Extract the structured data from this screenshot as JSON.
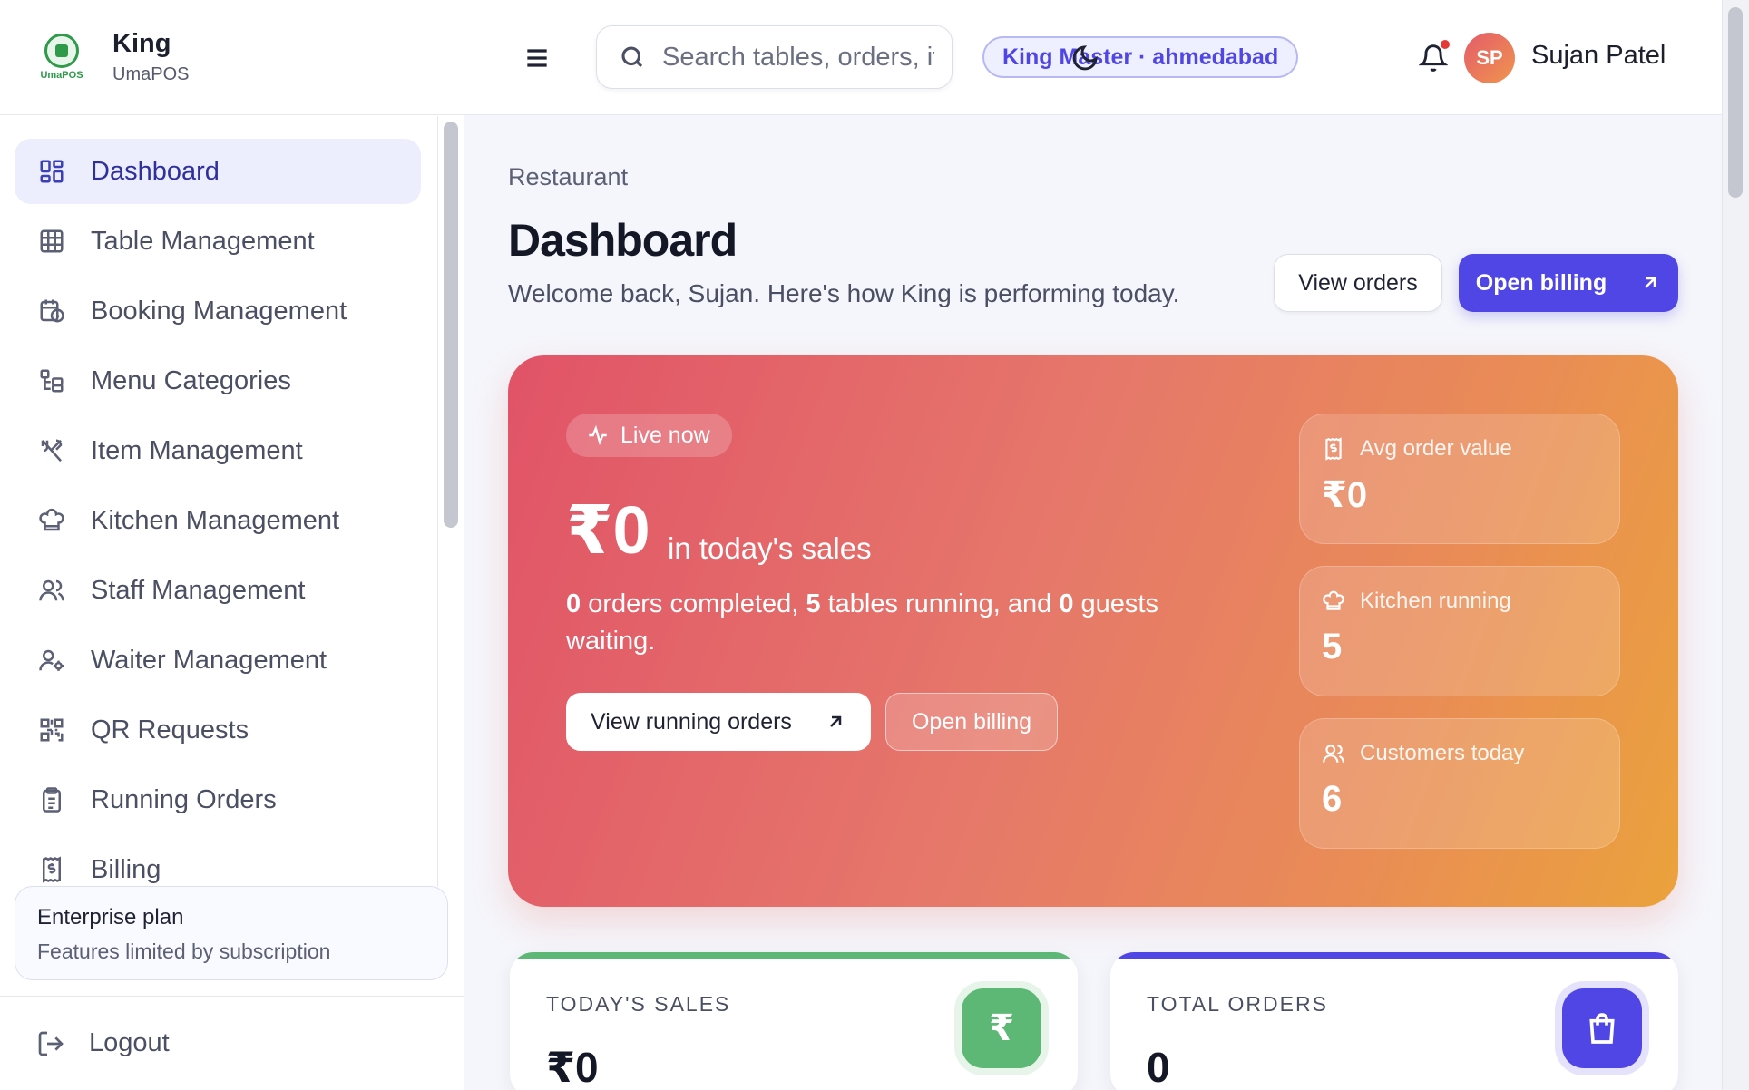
{
  "brand": {
    "name": "King",
    "sub": "UmaPOS",
    "logo_text": "UmaPOS"
  },
  "sidebar": {
    "items": [
      {
        "label": "Dashboard",
        "icon": "dashboard-icon",
        "active": true
      },
      {
        "label": "Table Management",
        "icon": "table-icon"
      },
      {
        "label": "Booking Management",
        "icon": "calendar-icon"
      },
      {
        "label": "Menu Categories",
        "icon": "categories-icon"
      },
      {
        "label": "Item Management",
        "icon": "utensils-icon"
      },
      {
        "label": "Kitchen Management",
        "icon": "chef-hat-icon"
      },
      {
        "label": "Staff Management",
        "icon": "users-icon"
      },
      {
        "label": "Waiter Management",
        "icon": "user-cog-icon"
      },
      {
        "label": "QR Requests",
        "icon": "qr-icon"
      },
      {
        "label": "Running Orders",
        "icon": "clipboard-icon"
      },
      {
        "label": "Billing",
        "icon": "receipt-icon"
      }
    ],
    "plan": {
      "title": "Enterprise plan",
      "subtitle": "Features limited by subscription"
    },
    "logout_label": "Logout"
  },
  "topbar": {
    "search_placeholder": "Search tables, orders, items",
    "branch": "King Master · ahmedabad",
    "user_initials": "SP",
    "user_name": "Sujan Patel"
  },
  "page": {
    "breadcrumb": "Restaurant",
    "title": "Dashboard",
    "welcome": "Welcome back, Sujan. Here's how King is performing today.",
    "view_orders_label": "View orders",
    "open_billing_label": "Open billing"
  },
  "hero": {
    "live_label": "Live now",
    "amount": "₹0",
    "amount_sub": "in today's sales",
    "orders_completed": "0",
    "orders_completed_text": " orders completed, ",
    "tables_running": "5",
    "tables_running_text": " tables running, and ",
    "guests_waiting": "0",
    "guests_waiting_text": " guests waiting.",
    "view_running_label": "View running orders",
    "open_billing_label": "Open billing",
    "stats": [
      {
        "label": "Avg order value",
        "value": "₹0",
        "icon": "receipt-icon"
      },
      {
        "label": "Kitchen running",
        "value": "5",
        "icon": "chef-hat-icon"
      },
      {
        "label": "Customers today",
        "value": "6",
        "icon": "users-icon"
      }
    ]
  },
  "kpis": [
    {
      "label": "TODAY'S SALES",
      "value": "₹0",
      "icon_glyph": "₹",
      "color": "#5cb874"
    },
    {
      "label": "TOTAL ORDERS",
      "value": "0",
      "icon": "shopping-bag-icon",
      "color": "#4f46e5"
    }
  ]
}
